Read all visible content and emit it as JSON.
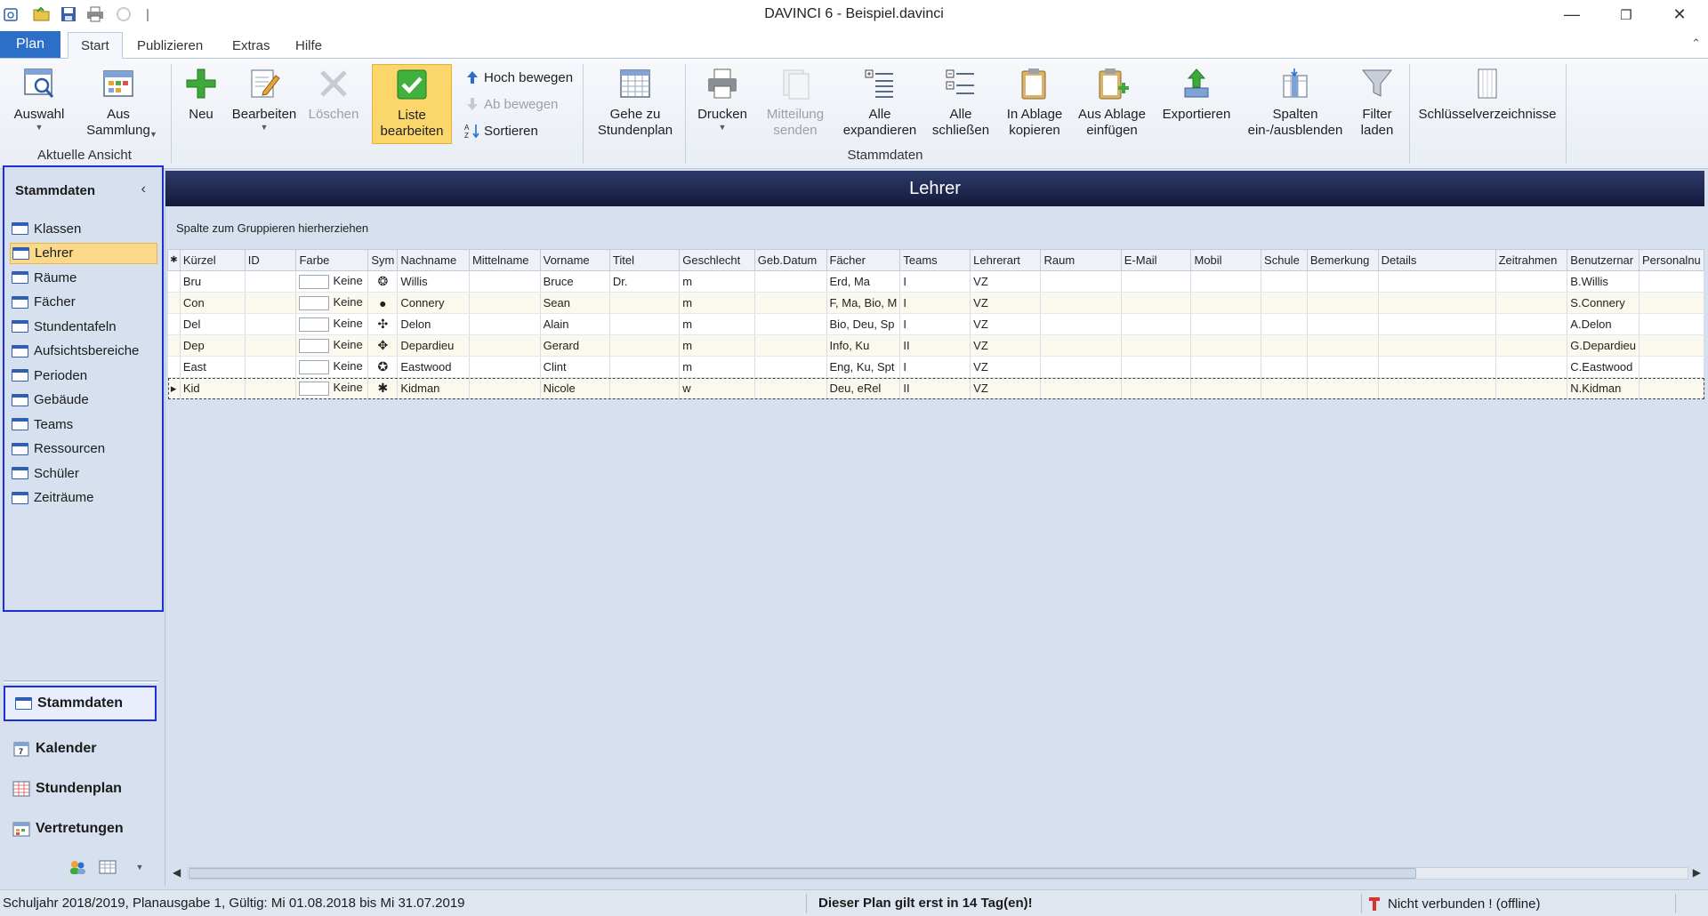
{
  "window": {
    "title": "DAVINCI 6 - Beispiel.davinci",
    "minimize": "—",
    "restore": "❐",
    "close": "✕"
  },
  "ribbon_tabs": {
    "plan": "Plan",
    "tabs": [
      "Start",
      "Publizieren",
      "Extras",
      "Hilfe"
    ],
    "active": "Start"
  },
  "ribbon": {
    "auswahl": "Auswahl",
    "aus_sammlung": "Aus\nSammlung",
    "aktuelle_ansicht": "Aktuelle Ansicht",
    "neu": "Neu",
    "bearbeiten": "Bearbeiten",
    "loeschen": "Löschen",
    "liste_bearbeiten": "Liste\nbearbeiten",
    "hoch_bewegen": "Hoch bewegen",
    "ab_bewegen": "Ab bewegen",
    "sortieren": "Sortieren",
    "gehe_zu": "Gehe zu\nStundenplan",
    "drucken": "Drucken",
    "mitteilung": "Mitteilung\nsenden",
    "alle_expandieren": "Alle\nexpandieren",
    "alle_schliessen": "Alle\nschließen",
    "in_ablage": "In Ablage\nkopieren",
    "aus_ablage": "Aus Ablage\neinfügen",
    "exportieren": "Exportieren",
    "spalten": "Spalten\nein-/ausblenden",
    "filter": "Filter\nladen",
    "schluessel": "Schlüsselverzeichnisse",
    "stammdaten_group": "Stammdaten"
  },
  "nav": {
    "header": "Stammdaten",
    "items": [
      "Klassen",
      "Lehrer",
      "Räume",
      "Fächer",
      "Stundentafeln",
      "Aufsichtsbereiche",
      "Perioden",
      "Gebäude",
      "Teams",
      "Ressourcen",
      "Schüler",
      "Zeiträume"
    ],
    "selected": "Lehrer",
    "bottom": [
      "Stammdaten",
      "Kalender",
      "Stundenplan",
      "Vertretungen"
    ],
    "bottom_active": "Stammdaten"
  },
  "panel": {
    "title": "Lehrer",
    "group_hint": "Spalte zum Gruppieren hierherziehen"
  },
  "grid": {
    "columns": [
      "✱",
      "Kürzel",
      "ID",
      "Farbe",
      "Sym",
      "Nachname",
      "Mittelname",
      "Vorname",
      "Titel",
      "Geschlecht",
      "Geb.Datum",
      "Fächer",
      "Teams",
      "Lehrerart",
      "Raum",
      "E-Mail",
      "Mobil",
      "Schule",
      "Bemerkung",
      "Details",
      "Zeitrahmen",
      "Benutzernar",
      "Personalnu"
    ],
    "rows": [
      {
        "kuerzel": "Bru",
        "id": "",
        "farbe": "Keine",
        "sym": "❂",
        "nachname": "Willis",
        "mittelname": "",
        "vorname": "Bruce",
        "titel": "Dr.",
        "geschlecht": "m",
        "geb": "",
        "faecher": "Erd, Ma",
        "teams": "I",
        "lehrerart": "VZ",
        "raum": "",
        "email": "",
        "mobil": "",
        "schule": "",
        "bemerkung": "",
        "details": "",
        "zeitrahmen": "",
        "benutzer": "B.Willis",
        "personal": ""
      },
      {
        "kuerzel": "Con",
        "id": "",
        "farbe": "Keine",
        "sym": "●",
        "nachname": "Connery",
        "mittelname": "",
        "vorname": "Sean",
        "titel": "",
        "geschlecht": "m",
        "geb": "",
        "faecher": "F, Ma, Bio, M",
        "teams": "I",
        "lehrerart": "VZ",
        "raum": "",
        "email": "",
        "mobil": "",
        "schule": "",
        "bemerkung": "",
        "details": "",
        "zeitrahmen": "",
        "benutzer": "S.Connery",
        "personal": ""
      },
      {
        "kuerzel": "Del",
        "id": "",
        "farbe": "Keine",
        "sym": "✣",
        "nachname": "Delon",
        "mittelname": "",
        "vorname": "Alain",
        "titel": "",
        "geschlecht": "m",
        "geb": "",
        "faecher": "Bio, Deu, Sp",
        "teams": "I",
        "lehrerart": "VZ",
        "raum": "",
        "email": "",
        "mobil": "",
        "schule": "",
        "bemerkung": "",
        "details": "",
        "zeitrahmen": "",
        "benutzer": "A.Delon",
        "personal": ""
      },
      {
        "kuerzel": "Dep",
        "id": "",
        "farbe": "Keine",
        "sym": "✥",
        "nachname": "Depardieu",
        "mittelname": "",
        "vorname": "Gerard",
        "titel": "",
        "geschlecht": "m",
        "geb": "",
        "faecher": "Info, Ku",
        "teams": "II",
        "lehrerart": "VZ",
        "raum": "",
        "email": "",
        "mobil": "",
        "schule": "",
        "bemerkung": "",
        "details": "",
        "zeitrahmen": "",
        "benutzer": "G.Depardieu",
        "personal": ""
      },
      {
        "kuerzel": "East",
        "id": "",
        "farbe": "Keine",
        "sym": "✪",
        "nachname": "Eastwood",
        "mittelname": "",
        "vorname": "Clint",
        "titel": "",
        "geschlecht": "m",
        "geb": "",
        "faecher": "Eng, Ku, Spt",
        "teams": "I",
        "lehrerart": "VZ",
        "raum": "",
        "email": "",
        "mobil": "",
        "schule": "",
        "bemerkung": "",
        "details": "",
        "zeitrahmen": "",
        "benutzer": "C.Eastwood",
        "personal": ""
      },
      {
        "kuerzel": "Kid",
        "id": "",
        "farbe": "Keine",
        "sym": "✱",
        "nachname": "Kidman",
        "mittelname": "",
        "vorname": "Nicole",
        "titel": "",
        "geschlecht": "w",
        "geb": "",
        "faecher": "Deu, eRel",
        "teams": "II",
        "lehrerart": "VZ",
        "raum": "",
        "email": "",
        "mobil": "",
        "schule": "",
        "bemerkung": "",
        "details": "",
        "zeitrahmen": "",
        "benutzer": "N.Kidman",
        "personal": ""
      }
    ],
    "current_row_marker": "▸"
  },
  "status": {
    "left": "Schuljahr 2018/2019, Planausgabe 1, Gültig: Mi 01.08.2018 bis Mi 31.07.2019",
    "middle": "Dieser Plan gilt erst in 14 Tag(en)!",
    "right": "Nicht verbunden ! (offline)"
  },
  "colors": {
    "accent": "#2b6fc8",
    "header_dark": "#1b2449",
    "selected_item": "#fbd98a",
    "focus_border": "#1d2fd6"
  }
}
